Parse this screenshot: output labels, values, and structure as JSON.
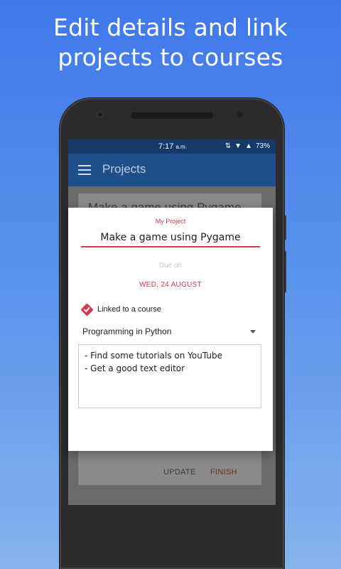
{
  "headline": {
    "line1": "Edit details and link",
    "line2": "projects to courses"
  },
  "status_bar": {
    "time": "7:17",
    "time_suffix": "a.m.",
    "battery": "73%",
    "icons": [
      "data-icon",
      "wifi-icon",
      "signal-icon"
    ]
  },
  "app_bar": {
    "title": "Projects"
  },
  "background_card": {
    "title": "Make a game using Pygame",
    "update_label": "UPDATE",
    "finish_label": "FINISH"
  },
  "fab": {
    "label": "+"
  },
  "dialog": {
    "title_label": "My Project",
    "title_value": "Make a game using Pygame",
    "due_label": "Due on",
    "due_date": "WED, 24 AUGUST",
    "linked_label": "Linked to a course",
    "linked_checked": true,
    "course": "Programming in Python",
    "notes": "- Find some tutorials on YouTube\n- Get a good text editor"
  },
  "colors": {
    "accent": "#d23a4e",
    "app_bar": "#1e4f8a",
    "status_bar": "#153a6a"
  }
}
